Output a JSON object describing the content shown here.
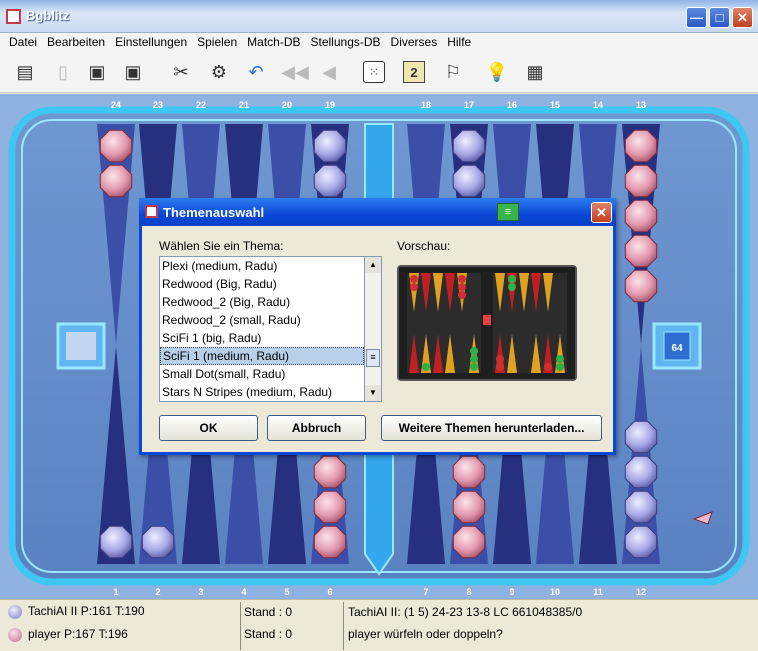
{
  "window": {
    "title": "Bgblitz",
    "minimize": "—",
    "maximize": "□",
    "close": "✕"
  },
  "menu": [
    "Datei",
    "Bearbeiten",
    "Einstellungen",
    "Spielen",
    "Match-DB",
    "Stellungs-DB",
    "Diverses",
    "Hilfe"
  ],
  "toolbar": [
    {
      "icon": "document-icon"
    },
    {
      "icon": "page-icon"
    },
    {
      "icon": "save-icon"
    },
    {
      "icon": "save-as-icon"
    },
    {
      "icon": "tools-icon"
    },
    {
      "icon": "settings-gear-icon"
    },
    {
      "icon": "undo-icon"
    },
    {
      "icon": "rewind-icon"
    },
    {
      "icon": "back-icon"
    },
    {
      "icon": "dice-icon"
    },
    {
      "icon": "doubling-cube-icon",
      "text": "2"
    },
    {
      "icon": "flag-icon"
    },
    {
      "icon": "hint-bulb-icon"
    },
    {
      "icon": "calculator-icon"
    }
  ],
  "board": {
    "top_numbers": [
      "24",
      "23",
      "22",
      "21",
      "20",
      "19",
      "18",
      "17",
      "16",
      "15",
      "14",
      "13"
    ],
    "bottom_numbers": [
      "1",
      "2",
      "3",
      "4",
      "5",
      "6",
      "7",
      "8",
      "9",
      "10",
      "11",
      "12"
    ],
    "cube_value": "64",
    "colors": {
      "pink_checker": "#e8a1b4",
      "blue_checker": "#a7a8e6",
      "frame": "#3ec7f2"
    }
  },
  "dialog": {
    "title": "Themenauswahl",
    "choose_label": "Wählen Sie ein Thema:",
    "preview_label": "Vorschau:",
    "themes": [
      "Plexi (medium, Radu)",
      "Redwood (Big, Radu)",
      "Redwood_2 (Big, Radu)",
      "Redwood_2 (small, Radu)",
      "SciFi 1 (big, Radu)",
      "SciFi 1 (medium, Radu)",
      "Small Dot(small, Radu)",
      "Stars N Stripes (medium, Radu)"
    ],
    "selected_index": 5,
    "ok": "OK",
    "cancel": "Abbruch",
    "download": "Weitere Themen herunterladen..."
  },
  "status": {
    "player1": "TachiAI II  P:161 T:190",
    "player2": "player  P:167 T:196",
    "stand1": "Stand : 0",
    "stand2": "Stand : 0",
    "info1": "TachiAI II: (1 5) 24-23 13-8    LC 661048385/0",
    "info2": "player würfeln oder doppeln?"
  }
}
